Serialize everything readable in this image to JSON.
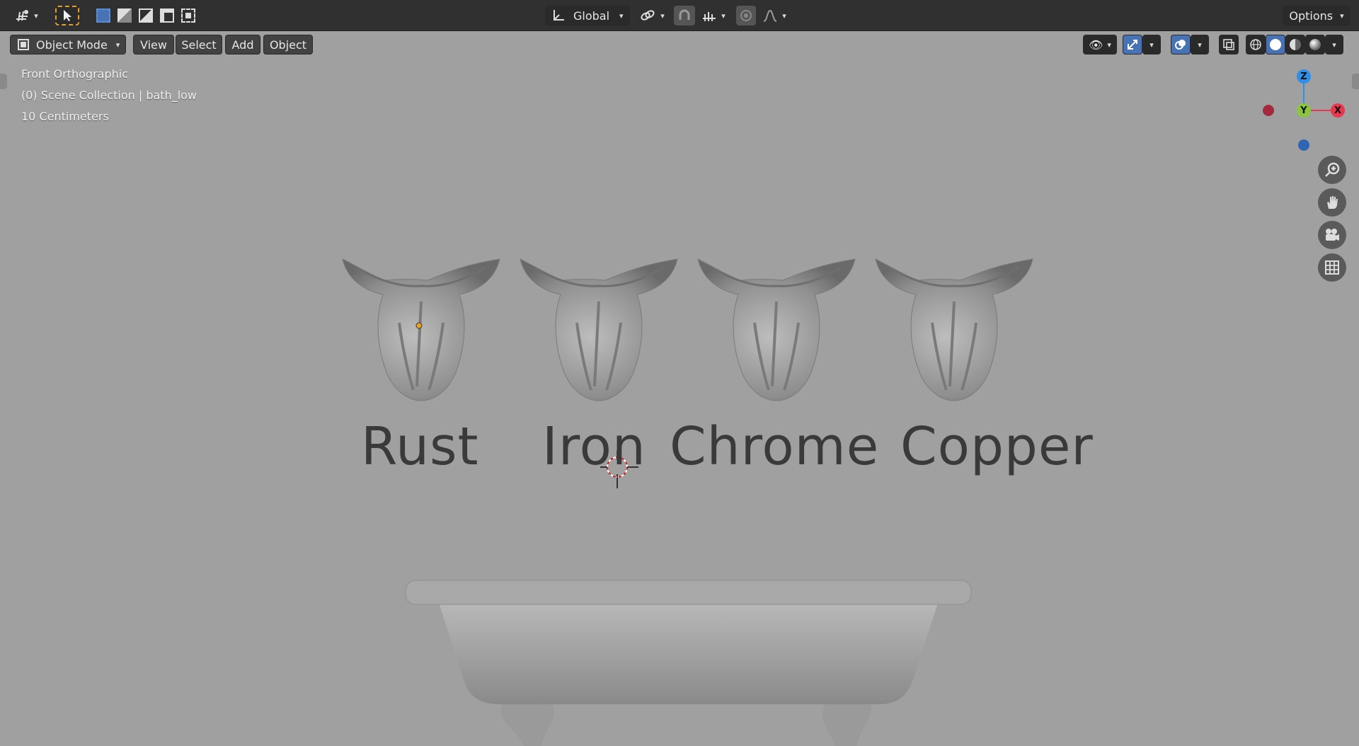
{
  "toolbar": {
    "transform_orientation": "Global",
    "options_label": "Options"
  },
  "header": {
    "mode": "Object Mode",
    "menus": [
      "View",
      "Select",
      "Add",
      "Object"
    ]
  },
  "viewport": {
    "view_name": "Front Orthographic",
    "collection_info": "(0) Scene Collection | bath_low",
    "grid_scale": "10 Centimeters",
    "labels": [
      "Rust",
      "Iron",
      "Chrome",
      "Copper"
    ]
  },
  "gizmo": {
    "z": "Z",
    "y": "Y",
    "x": "X",
    "colors": {
      "x": "#e8384f",
      "y": "#8bc53f",
      "z": "#2f8fe6",
      "neg_x": "#a32a3c",
      "neg_z": "#2f66b3"
    }
  }
}
